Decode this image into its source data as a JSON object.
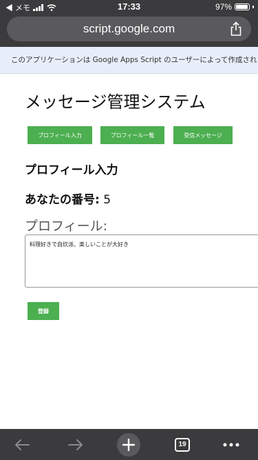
{
  "status_bar": {
    "back_label": "◀ メモ",
    "time": "17:33",
    "battery_text": "97%",
    "battery_level": 0.97
  },
  "browser": {
    "url": "script.google.com",
    "tab_count": "19"
  },
  "banner": {
    "text": "このアプリケーションは Google Apps Script のユーザーによって作成されました"
  },
  "page": {
    "title": "メッセージ管理システム",
    "nav_buttons": [
      {
        "label": "プロフィール入力"
      },
      {
        "label": "プロフィール一覧"
      },
      {
        "label": "受信メッセージ"
      }
    ],
    "section_title": "プロフィール入力",
    "number_label": "あなたの番号:",
    "number_value": "5",
    "profile_label": "プロフィール:",
    "profile_value": "料理好きで自炊派、楽しいことが大好き",
    "register_label": "登録"
  },
  "colors": {
    "button_green": "#4caf50",
    "chrome_dark": "#3b3b3d",
    "banner_bg": "#e8eef9"
  },
  "icons": [
    "cellular-signal-icon",
    "wifi-icon",
    "battery-icon",
    "share-icon",
    "back-arrow-icon",
    "forward-arrow-icon",
    "new-tab-plus-icon",
    "tabs-icon",
    "more-icon"
  ]
}
